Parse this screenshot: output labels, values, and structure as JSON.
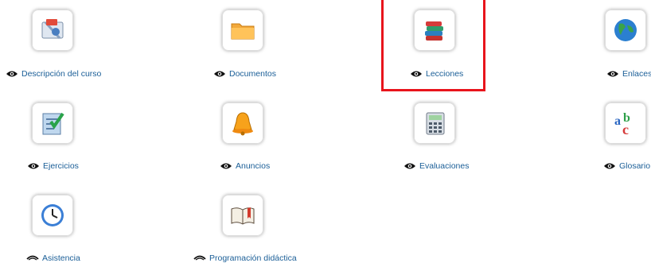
{
  "tools": [
    {
      "id": "descripcion",
      "label": "Descripción del curso",
      "icon": "course-description-icon",
      "eye": "visible"
    },
    {
      "id": "documentos",
      "label": "Documentos",
      "icon": "folder-icon",
      "eye": "visible"
    },
    {
      "id": "lecciones",
      "label": "Lecciones",
      "icon": "books-icon",
      "eye": "visible",
      "highlighted": true
    },
    {
      "id": "enlaces",
      "label": "Enlaces",
      "icon": "globe-icon",
      "eye": "visible"
    },
    {
      "id": "ejercicios",
      "label": "Ejercicios",
      "icon": "checklist-icon",
      "eye": "visible"
    },
    {
      "id": "anuncios",
      "label": "Anuncios",
      "icon": "bell-icon",
      "eye": "visible"
    },
    {
      "id": "evaluaciones",
      "label": "Evaluaciones",
      "icon": "calculator-icon",
      "eye": "visible"
    },
    {
      "id": "glosario",
      "label": "Glosario",
      "icon": "abc-letters-icon",
      "eye": "visible"
    },
    {
      "id": "asistencia",
      "label": "Asistencia",
      "icon": "clock-icon",
      "eye": "hidden"
    },
    {
      "id": "programacion",
      "label": "Programación didáctica",
      "icon": "open-book-icon",
      "eye": "hidden"
    }
  ],
  "colors": {
    "link": "#1a5e97",
    "highlight": "#e8141c"
  }
}
